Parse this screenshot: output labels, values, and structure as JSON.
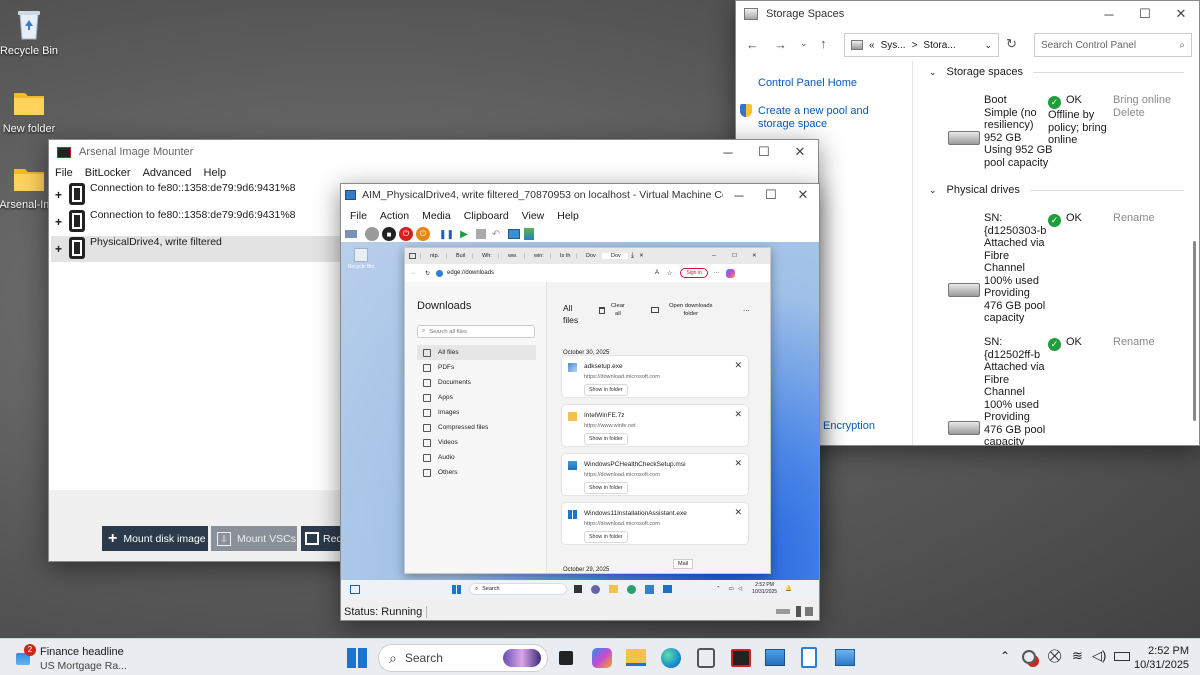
{
  "desktop": {
    "icons": [
      {
        "label": "Recycle Bin"
      },
      {
        "label": "New folder"
      },
      {
        "label": "Arsenal-Ima"
      }
    ]
  },
  "storage": {
    "title": "Storage Spaces",
    "breadcrumb": [
      "«",
      "Sys...",
      ">",
      "Stora..."
    ],
    "search_placeholder": "Search Control Panel",
    "left_links": [
      "Control Panel Home",
      "Create a new pool and storage space"
    ],
    "encryption_link": "Encryption",
    "spaces_heading": "Storage spaces",
    "space": {
      "lines": [
        "Boot",
        "Simple (no",
        "resiliency)",
        "952 GB",
        "Using 952 GB",
        "pool capacity"
      ],
      "status": "OK",
      "status_detail": [
        "Offline by",
        "policy; bring",
        "online"
      ],
      "actions": [
        "Bring online",
        "Delete"
      ]
    },
    "drives_heading": "Physical drives",
    "drives": [
      {
        "lines": [
          "SN:",
          "{d1250303-b",
          "Attached via",
          "Fibre",
          "Channel",
          "100% used",
          "Providing",
          "476 GB pool",
          "capacity"
        ],
        "status": "OK",
        "action": "Rename"
      },
      {
        "lines": [
          "SN:",
          "{d12502ff-b",
          "Attached via",
          "Fibre",
          "Channel",
          "100% used",
          "Providing",
          "476 GB pool",
          "capacity"
        ],
        "status": "OK",
        "action": "Rename"
      }
    ]
  },
  "aim": {
    "title": "Arsenal Image Mounter",
    "menu": [
      "File",
      "BitLocker",
      "Advanced",
      "Help"
    ],
    "rows": [
      {
        "expander": "+",
        "label": "Connection to fe80::1358:de79:9d6:9431%8"
      },
      {
        "expander": "+",
        "label": "Connection to fe80::1358:de79:9d6:9431%8"
      },
      {
        "expander": "+",
        "label": "PhysicalDrive4, write filtered"
      }
    ],
    "buttons": {
      "mount_image": "Mount disk image",
      "mount_vscs": "Mount VSCs",
      "rec": "Rec"
    }
  },
  "vm": {
    "title": "AIM_PhysicalDrive4, write filtered_70870953 on localhost - Virtual Machine Connec...",
    "menu": [
      "File",
      "Action",
      "Media",
      "Clipboard",
      "View",
      "Help"
    ],
    "status": "Status: Running",
    "guest_desktop_label": "Recycle Bin",
    "guest_time": "2:52 PM",
    "guest_date": "10/31/2025",
    "guest_search": "Search",
    "mail_tooltip": "Mail"
  },
  "edge": {
    "tabs": [
      "ntp.",
      "Buil",
      "Wh:",
      "ww.",
      "win:",
      "Is th",
      "Dov",
      "Dov"
    ],
    "address": "edge://downloads",
    "sign_in": "Sign in",
    "downloads_title": "Downloads",
    "search_placeholder": "Search all files",
    "nav": [
      "All files",
      "PDFs",
      "Documents",
      "Apps",
      "Images",
      "Compressed files",
      "Videos",
      "Audio",
      "Others"
    ],
    "main_title": [
      "All",
      "files"
    ],
    "clear_all": [
      "Clear",
      "all"
    ],
    "open_folder": [
      "Open downloads",
      "folder"
    ],
    "more": "...",
    "date1": "October 30, 2025",
    "date2": "October 29, 2025",
    "items": [
      {
        "name": "adksetup.exe",
        "url": "https://download.microsoft.com",
        "button": "Show in folder"
      },
      {
        "name": "IntelWinFE.7z",
        "url": "https://www.winfe.net",
        "button": "Show in folder"
      },
      {
        "name": "WindowsPCHealthCheckSetup.msi",
        "url": "https://download.microsoft.com",
        "button": "Show in folder"
      },
      {
        "name": "Windows11InstallationAssistant.exe",
        "url": "https://download.microsoft.com",
        "button": "Show in folder"
      }
    ]
  },
  "taskbar": {
    "news_badge": "2",
    "news_title": "Finance headline",
    "news_sub": "US Mortgage Ra...",
    "search": "Search",
    "time": "2:52 PM",
    "date": "10/31/2025"
  },
  "colors": {
    "accent": "#0a5ab6",
    "ok": "#1f9d3a",
    "aim_button": "#2b3b4c",
    "vm_bg": "#9cb9dc"
  }
}
